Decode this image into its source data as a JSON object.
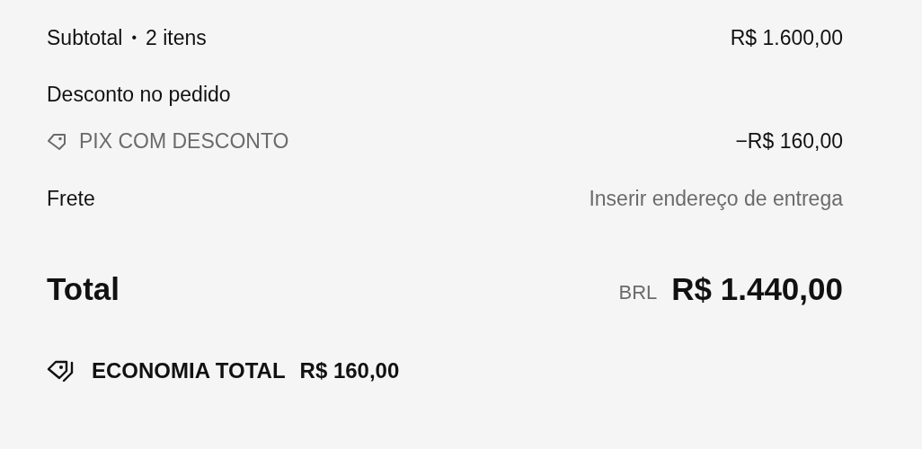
{
  "subtotal": {
    "label": "Subtotal",
    "separator": "•",
    "count": "2 itens",
    "amount": "R$ 1.600,00"
  },
  "discount": {
    "heading": "Desconto no pedido",
    "code": "PIX COM DESCONTO",
    "amount": "−R$ 160,00"
  },
  "shipping": {
    "label": "Frete",
    "value": "Inserir endereço de entrega"
  },
  "total": {
    "label": "Total",
    "currency": "BRL",
    "amount": "R$ 1.440,00"
  },
  "savings": {
    "label": "ECONOMIA TOTAL",
    "amount": "R$ 160,00"
  }
}
